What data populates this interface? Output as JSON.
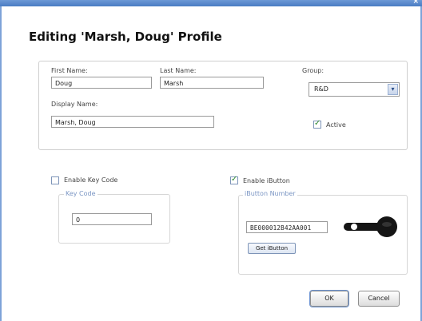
{
  "window": {
    "close_glyph": "×"
  },
  "title": "Editing 'Marsh, Doug' Profile",
  "profile": {
    "first_name_label": "First Name:",
    "first_name": "Doug",
    "last_name_label": "Last Name:",
    "last_name": "Marsh",
    "display_name_label": "Display Name:",
    "display_name": "Marsh, Doug"
  },
  "group": {
    "label": "Group:",
    "selected": "R&D",
    "arrow": "▾",
    "active_label": "Active",
    "active_checked": true
  },
  "key_code": {
    "enable_label": "Enable Key Code",
    "enabled": false,
    "legend": "Key Code",
    "value": "0"
  },
  "ibutton": {
    "enable_label": "Enable iButton",
    "enabled": true,
    "legend": "iButton Number",
    "number": "BE000012B42AA001",
    "get_button": "Get iButton",
    "icon": "ibutton-key-fob-icon"
  },
  "checkmark_glyph": "✓",
  "actions": {
    "ok": "OK",
    "cancel": "Cancel"
  }
}
